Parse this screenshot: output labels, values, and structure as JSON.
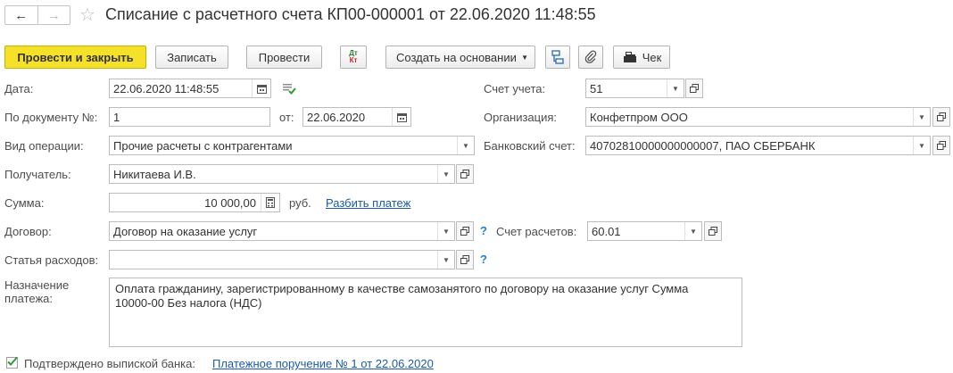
{
  "header": {
    "title": "Списание с расчетного счета КП00-000001 от 22.06.2020 11:48:55",
    "back": "←",
    "forward": "→",
    "star": "☆"
  },
  "toolbar": {
    "post_close": "Провести и закрыть",
    "save": "Записать",
    "post": "Провести",
    "dtkt_top": "Дт",
    "dtkt_bottom": "Кт",
    "create_based": "Создать на основании",
    "receipt": "Чек"
  },
  "form": {
    "date": {
      "label": "Дата:",
      "value": "22.06.2020 11:48:55"
    },
    "doc_no": {
      "label": "По документу №:",
      "value": "1"
    },
    "doc_from": {
      "label": "от:",
      "value": "22.06.2020"
    },
    "operation": {
      "label": "Вид операции:",
      "value": "Прочие расчеты с контрагентами"
    },
    "recipient": {
      "label": "Получатель:",
      "value": "Никитаева И.В."
    },
    "amount": {
      "label": "Сумма:",
      "value": "10 000,00",
      "currency": "руб.",
      "split_link": "Разбить платеж"
    },
    "contract": {
      "label": "Договор:",
      "value": "Договор на оказание услуг",
      "help": "?"
    },
    "settlement_account": {
      "label": "Счет расчетов:",
      "value": "60.01"
    },
    "expense_item": {
      "label": "Статья расходов:",
      "value": "",
      "help": "?"
    },
    "purpose": {
      "label1": "Назначение",
      "label2": "платежа:",
      "line1": "Оплата гражданину, зарегистрированному в качестве самозанятого по договору на оказание услуг Сумма",
      "line2": "10000-00 Без налога (НДС)"
    },
    "account": {
      "label": "Счет учета:",
      "value": "51"
    },
    "organization": {
      "label": "Организация:",
      "value": "Конфетпром ООО"
    },
    "bank_account": {
      "label": "Банковский счет:",
      "value": "40702810000000000007, ПАО СБЕРБАНК"
    }
  },
  "footer": {
    "confirmed_label": "Подтверждено выпиской банка:",
    "confirmed_checked": true,
    "payment_order_link": "Платежное поручение № 1 от 22.06.2020"
  }
}
